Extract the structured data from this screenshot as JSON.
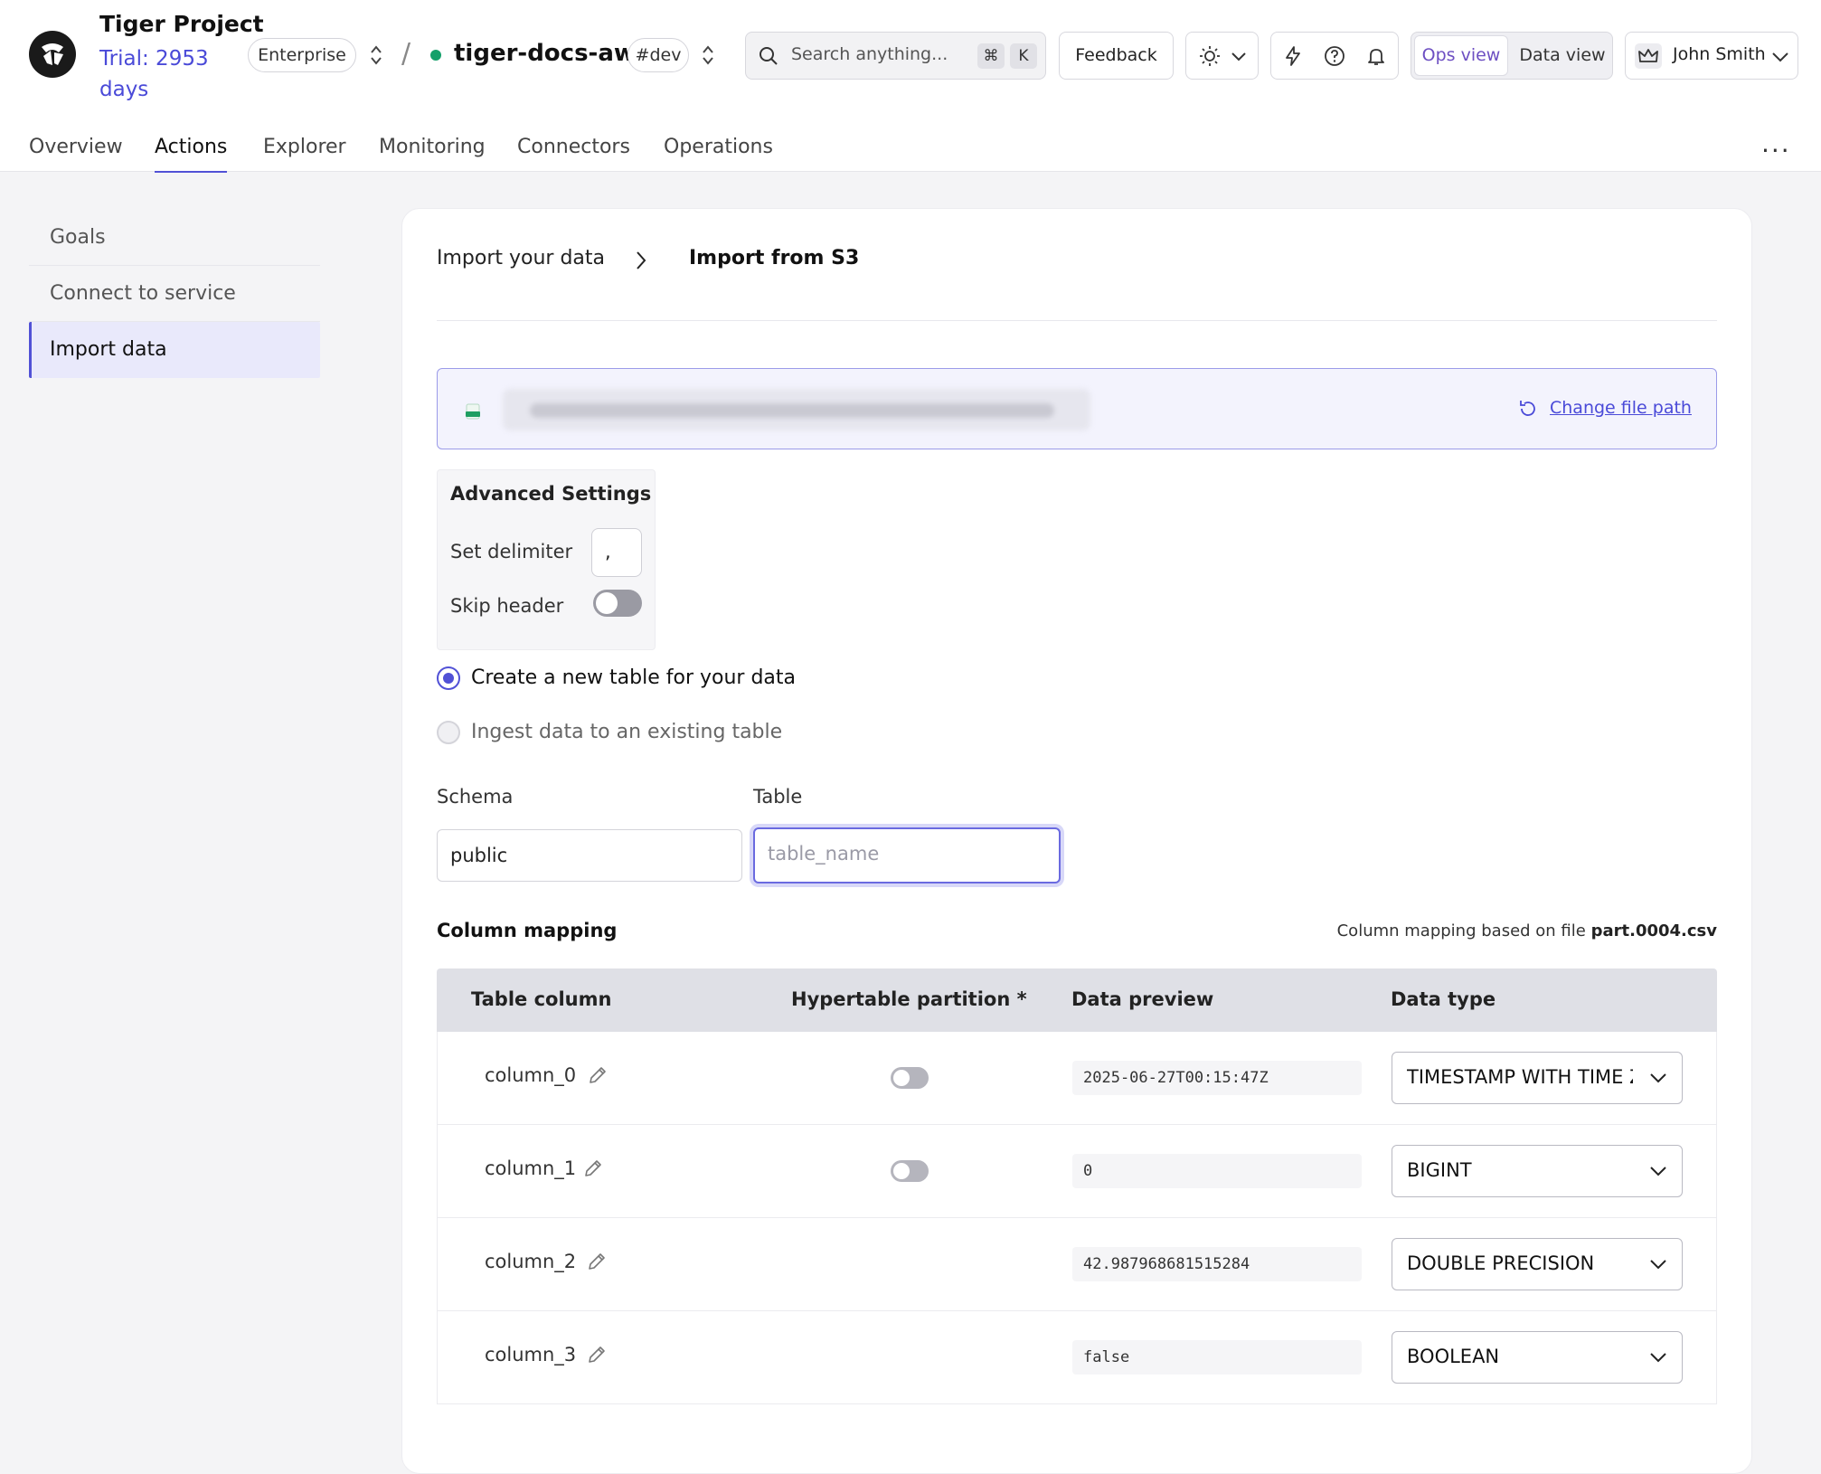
{
  "project": {
    "title": "Tiger Project",
    "trial": "Trial: 2953 days"
  },
  "header": {
    "plan_badge": "Enterprise",
    "service_name": "tiger-docs-aws",
    "env_badge": "#dev",
    "search_placeholder": "Search anything...",
    "shortcut_cmd": "⌘",
    "shortcut_key": "K",
    "feedback_label": "Feedback",
    "ops_view_label": "Ops view",
    "data_view_label": "Data view",
    "user_name": "John Smith"
  },
  "nav": {
    "tabs": [
      "Overview",
      "Actions",
      "Explorer",
      "Monitoring",
      "Connectors",
      "Operations"
    ],
    "active": "Actions",
    "more": "···"
  },
  "sidebar": {
    "items": [
      "Goals",
      "Connect to service",
      "Import data"
    ],
    "active": "Import data"
  },
  "breadcrumb": {
    "parent": "Import your data",
    "current": "Import from S3"
  },
  "file": {
    "change_path_label": "Change file path"
  },
  "advanced": {
    "title": "Advanced Settings",
    "delimiter_label": "Set delimiter",
    "delimiter_value": ",",
    "skip_header_label": "Skip header",
    "skip_header_on": false
  },
  "table_choice": {
    "create_label": "Create a new table for your data",
    "existing_label": "Ingest data to an existing table",
    "selected": "create"
  },
  "form": {
    "schema_label": "Schema",
    "schema_value": "public",
    "table_label": "Table",
    "table_placeholder": "table_name"
  },
  "mapping": {
    "title": "Column mapping",
    "note_prefix": "Column mapping based on file",
    "note_file": "part.0004.csv",
    "headers": [
      "Table column",
      "Hypertable partition *",
      "Data preview",
      "Data type"
    ],
    "rows": [
      {
        "name": "column_0",
        "partition_toggle": true,
        "preview": "2025-06-27T00:15:47Z",
        "type": "TIMESTAMP WITH TIME ZONE"
      },
      {
        "name": "column_1",
        "partition_toggle": true,
        "preview": "0",
        "type": "BIGINT"
      },
      {
        "name": "column_2",
        "partition_toggle": false,
        "preview": "42.987968681515284",
        "type": "DOUBLE PRECISION"
      },
      {
        "name": "column_3",
        "partition_toggle": false,
        "preview": "false",
        "type": "BOOLEAN"
      }
    ]
  },
  "colors": {
    "accent": "#5151d6",
    "link": "#4a4ad8",
    "status_green": "#14a06a"
  }
}
